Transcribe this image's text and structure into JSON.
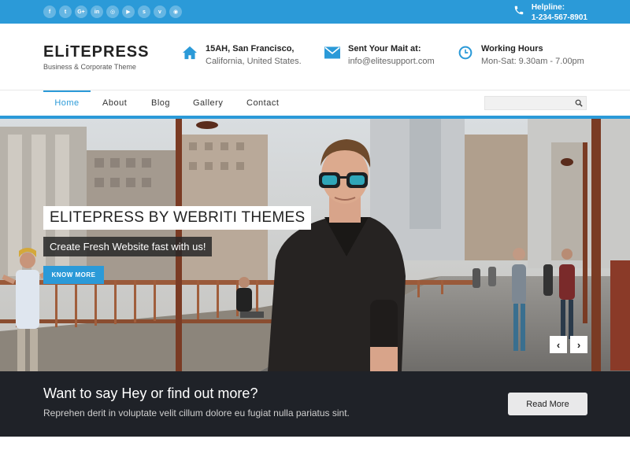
{
  "social": {
    "icons": [
      {
        "name": "facebook-icon",
        "glyph": "f"
      },
      {
        "name": "twitter-icon",
        "glyph": "t"
      },
      {
        "name": "googleplus-icon",
        "glyph": "G+"
      },
      {
        "name": "linkedin-icon",
        "glyph": "in"
      },
      {
        "name": "instagram-icon",
        "glyph": "◎"
      },
      {
        "name": "youtube-icon",
        "glyph": "▶"
      },
      {
        "name": "skype-icon",
        "glyph": "s"
      },
      {
        "name": "vimeo-icon",
        "glyph": "v"
      },
      {
        "name": "dribbble-icon",
        "glyph": "◉"
      }
    ]
  },
  "topbar": {
    "helpline_label": "Helpline:",
    "helpline_number": "1-234-567-8901"
  },
  "brand": {
    "logo_text": "ELiTEPRESS",
    "tagline": "Business & Corporate Theme"
  },
  "header_info": {
    "address": {
      "title": "15AH, San Francisco,",
      "text": "California, United States."
    },
    "mail": {
      "title": "Sent Your Mait at:",
      "text": "info@elitesupport.com"
    },
    "hours": {
      "title": "Working Hours",
      "text": "Mon-Sat: 9.30am - 7.00pm"
    }
  },
  "nav": {
    "items": [
      "Home",
      "About",
      "Blog",
      "Gallery",
      "Contact"
    ],
    "active": "Home",
    "search_placeholder": ""
  },
  "hero": {
    "title": "ELITEPRESS BY WEBRITI THEMES",
    "subtitle": "Create Fresh Website fast  with us!",
    "button_label": "KNOW MORE",
    "prev_label": "‹",
    "next_label": "›"
  },
  "cta": {
    "title": "Want to say Hey or find out more?",
    "text": "Reprehen derit in voluptate velit cillum dolore eu fugiat nulla pariatus  sint.",
    "button_label": "Read More"
  },
  "colors": {
    "accent": "#2b9ad8",
    "dark_band": "#1f2228"
  }
}
